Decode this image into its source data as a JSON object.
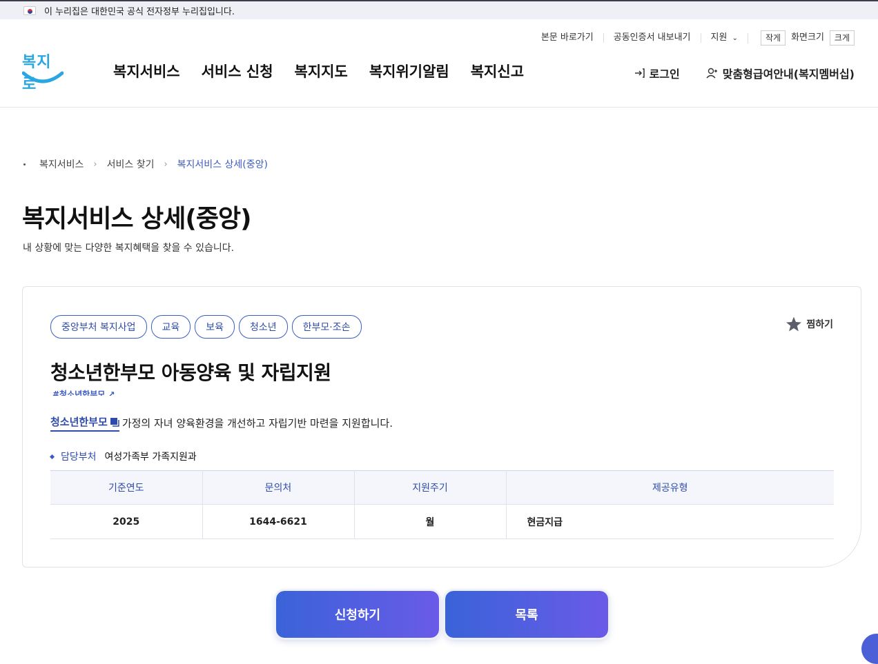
{
  "gov_banner": {
    "text": "이 누리집은 대한민국 공식 전자정부 누리집입니다."
  },
  "utility": {
    "skip_link": "본문 바로가기",
    "cert_export": "공동인증서 내보내기",
    "region": "지원",
    "font_small": "작게",
    "font_label": "화면크기",
    "font_large": "크게"
  },
  "logo": {
    "text": "복지로"
  },
  "gnb": {
    "items": [
      "복지서비스",
      "서비스 신청",
      "복지지도",
      "복지위기알림",
      "복지신고"
    ],
    "login": "로그인",
    "membership": "맞춤형급여안내(복지멤버십)"
  },
  "breadcrumb": [
    "복지서비스",
    "서비스 찾기",
    "복지서비스 상세(중앙)"
  ],
  "page": {
    "title": "복지서비스 상세(중앙)",
    "description": "내 상황에 맞는 다양한 복지혜택을 찾을 수 있습니다."
  },
  "service": {
    "tags": [
      "중앙부처 복지사업",
      "교육",
      "보육",
      "청소년",
      "한부모·조손"
    ],
    "favorite": "찜하기",
    "title": "청소년한부모 아동양육 및 자립지원",
    "hashtag": "#청소년한부모",
    "summary_link": "청소년한부모",
    "summary_text": "가정의 자녀 양육환경을 개선하고 자립기반 마련을 지원합니다.",
    "dept_label": "담당부처",
    "dept_value": "여성가족부 가족지원과",
    "table": {
      "headers": [
        "기준연도",
        "문의처",
        "지원주기",
        "제공유형"
      ],
      "row": [
        "2025",
        "1644-6621",
        "월",
        "현금지급"
      ]
    }
  },
  "buttons": {
    "apply": "신청하기",
    "list": "목록"
  },
  "colors": {
    "accent": "#3b5bc4",
    "button_start": "#3a63d8",
    "button_end": "#6a5ae8"
  }
}
